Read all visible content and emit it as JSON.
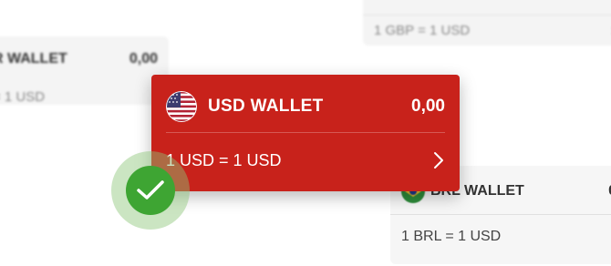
{
  "cards": {
    "gbp": {
      "rate": "1 GBP = 1 USD"
    },
    "eur": {
      "title": "R WALLET",
      "amount": "0,00",
      "rate": "= 1 USD"
    },
    "brl": {
      "title": "BRL WALLET",
      "amount": "0",
      "rate": "1 BRL = 1 USD"
    }
  },
  "main": {
    "title": "USD WALLET",
    "amount": "0,00",
    "rate": "1 USD = 1 USD",
    "flag_icon": "us-flag-icon",
    "chevron_icon": "chevron-right-icon",
    "accent": "#c8221b"
  },
  "badge": {
    "icon": "checkmark-icon",
    "color": "#3ea533"
  }
}
